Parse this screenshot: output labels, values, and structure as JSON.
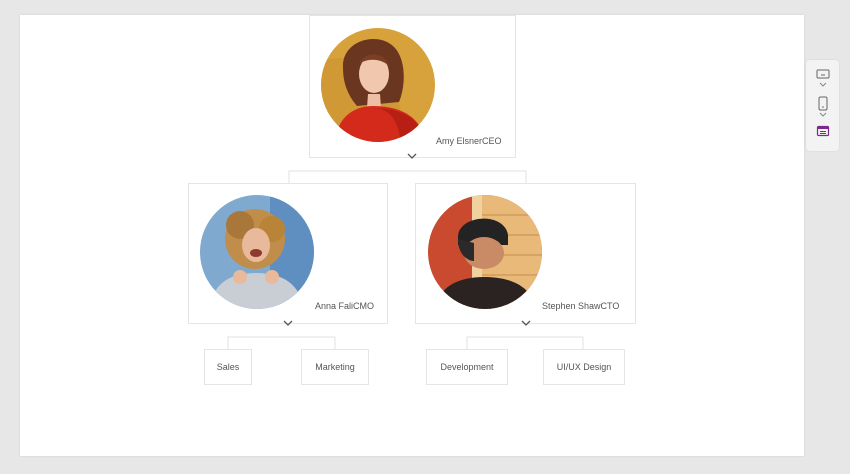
{
  "org_chart": {
    "root": {
      "name": "Amy Elsner",
      "role": "CEO"
    },
    "managers": [
      {
        "name": "Anna Fali",
        "role": "CMO",
        "teams": [
          "Sales",
          "Marketing"
        ]
      },
      {
        "name": "Stephen Shaw",
        "role": "CTO",
        "teams": [
          "Development",
          "UI/UX Design"
        ]
      }
    ]
  },
  "colors": {
    "background": "#e7e7e7",
    "canvas": "#ffffff",
    "border": "#e5e5e5",
    "connector": "#e0e0e0",
    "text": "#555555",
    "accent": "#7b2a8c"
  },
  "icons": {
    "collapse": "chevron-down-icon",
    "panel": [
      "monitor-icon",
      "phone-icon",
      "calendar-icon"
    ]
  }
}
